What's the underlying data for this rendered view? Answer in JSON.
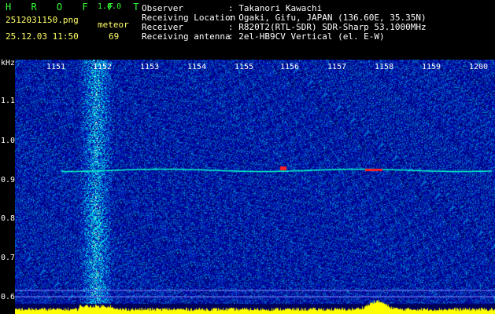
{
  "header": {
    "app_name": "H R O F F T",
    "version": "1.0.0",
    "filename": "2512031150.png",
    "meteor_label": "meteor",
    "datetime": "25.12.03 11:50",
    "meteor_count": "69",
    "info": [
      {
        "label": "Observer",
        "value": ": Takanori Kawachi"
      },
      {
        "label": "Receiving Location",
        "value": ": Ogaki, Gifu, JAPAN (136.60E, 35.35N)"
      },
      {
        "label": "Receiver",
        "value": ": R820T2(RTL-SDR) SDR-Sharp 53.1000MHz"
      },
      {
        "label": "Receiving antenna",
        "value": ": 2el-HB9CV Vertical (el. E-W)"
      }
    ]
  },
  "spectrogram": {
    "unit": "kHz",
    "y_ticks": [
      "1.1",
      "1.0",
      "0.9",
      "0.8",
      "0.7",
      "0.6"
    ],
    "x_ticks": [
      "1151",
      "1152",
      "1153",
      "1154",
      "1155",
      "1156",
      "1157",
      "1158",
      "1159",
      "1200"
    ],
    "colors": {
      "background": "#000080",
      "trace": "#00ffcc",
      "hot": "#ff2020",
      "histogram": "#ffff00"
    }
  }
}
